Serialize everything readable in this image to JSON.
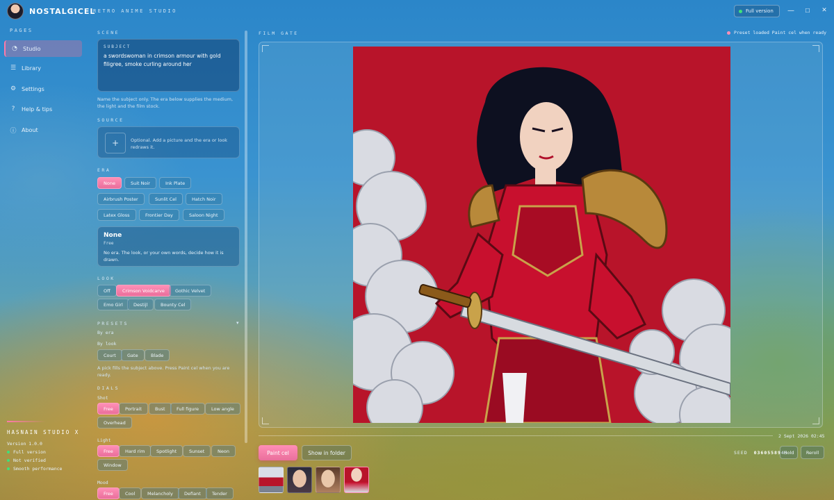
{
  "app": {
    "brand": "NOSTALGICEL",
    "subtitle": "RETRO ANIME STUDIO",
    "full_version": "Full version",
    "window_controls": {
      "minimize": "—",
      "maximize": "☐",
      "close": "✕"
    }
  },
  "nav": {
    "title": "PAGES",
    "items": [
      {
        "label": "Studio",
        "icon": "palette-icon",
        "active": true
      },
      {
        "label": "Library",
        "icon": "list-icon",
        "active": false
      },
      {
        "label": "Settings",
        "icon": "gear-icon",
        "active": false
      },
      {
        "label": "Help & tips",
        "icon": "question-icon",
        "active": false
      },
      {
        "label": "About",
        "icon": "info-icon",
        "active": false
      }
    ],
    "studio": {
      "name": "HASNAIN STUDIO X",
      "version": "Version 1.0.0",
      "statuses": [
        "Full version",
        "Not verified",
        "Smooth performance"
      ]
    }
  },
  "panel": {
    "scene_title": "SCENE",
    "subject_label": "SUBJECT",
    "subject_value": "a swordswoman in crimson armour with gold filigree, smoke curling around her",
    "subject_hint": "Name the subject only. The era below supplies the medium, the light and the film stock.",
    "source_title": "SOURCE",
    "source_plus": "+",
    "source_hint": "Optional. Add a picture and the era or look redraws it.",
    "era_title": "ERA",
    "era_options": [
      "None",
      "Suit Noir",
      "Ink Plate",
      "Airbrush Poster",
      "Sunlit Cel",
      "Hatch Noir",
      "Latex Gloss",
      "Frontier Day",
      "Saloon Night"
    ],
    "era_selected": "None",
    "era_card": {
      "name": "None",
      "tag": "Free",
      "description": "No era. The look, or your own words, decide how it is drawn."
    },
    "look_title": "LOOK",
    "look_options": [
      "Off",
      "Crimson Voidcarve",
      "Gothic Velvet",
      "Emo Girl",
      "Destijl",
      "Bounty Cel"
    ],
    "look_selected": "Crimson Voidcarve",
    "presets_title": "PRESETS",
    "presets_caret": "▾",
    "presets_by_era": "By era",
    "presets_by_look": "By look",
    "preset_options": [
      "Court",
      "Gate",
      "Blade"
    ],
    "presets_hint": "A pick fills the subject above. Press Paint cel when you are ready.",
    "dials_title": "DIALS",
    "shot_label": "Shot",
    "shot_options": [
      "Free",
      "Portrait",
      "Bust",
      "Full figure",
      "Low angle",
      "Overhead"
    ],
    "shot_selected": "Free",
    "light_label": "Light",
    "light_options": [
      "Free",
      "Hard rim",
      "Spotlight",
      "Sunset",
      "Neon",
      "Window"
    ],
    "light_selected": "Free",
    "mood_label": "Mood",
    "mood_options": [
      "Free",
      "Cool",
      "Melancholy",
      "Defiant",
      "Tender"
    ],
    "mood_selected": "Free"
  },
  "gate": {
    "title": "FILM GATE",
    "status": "Preset loaded  Paint cel when ready",
    "timestamp": "2 Sept 2026  02:45"
  },
  "actions": {
    "paint": "Paint cel",
    "show_folder": "Show in folder",
    "seed_label": "SEED",
    "seed_value": "0360558945",
    "hold": "Hold",
    "reroll": "Reroll"
  },
  "colors": {
    "accent_pink": "#ff8fb6",
    "status_green": "#3fe07a",
    "armour_red": "#c8102e",
    "backdrop_red": "#b8142a"
  }
}
